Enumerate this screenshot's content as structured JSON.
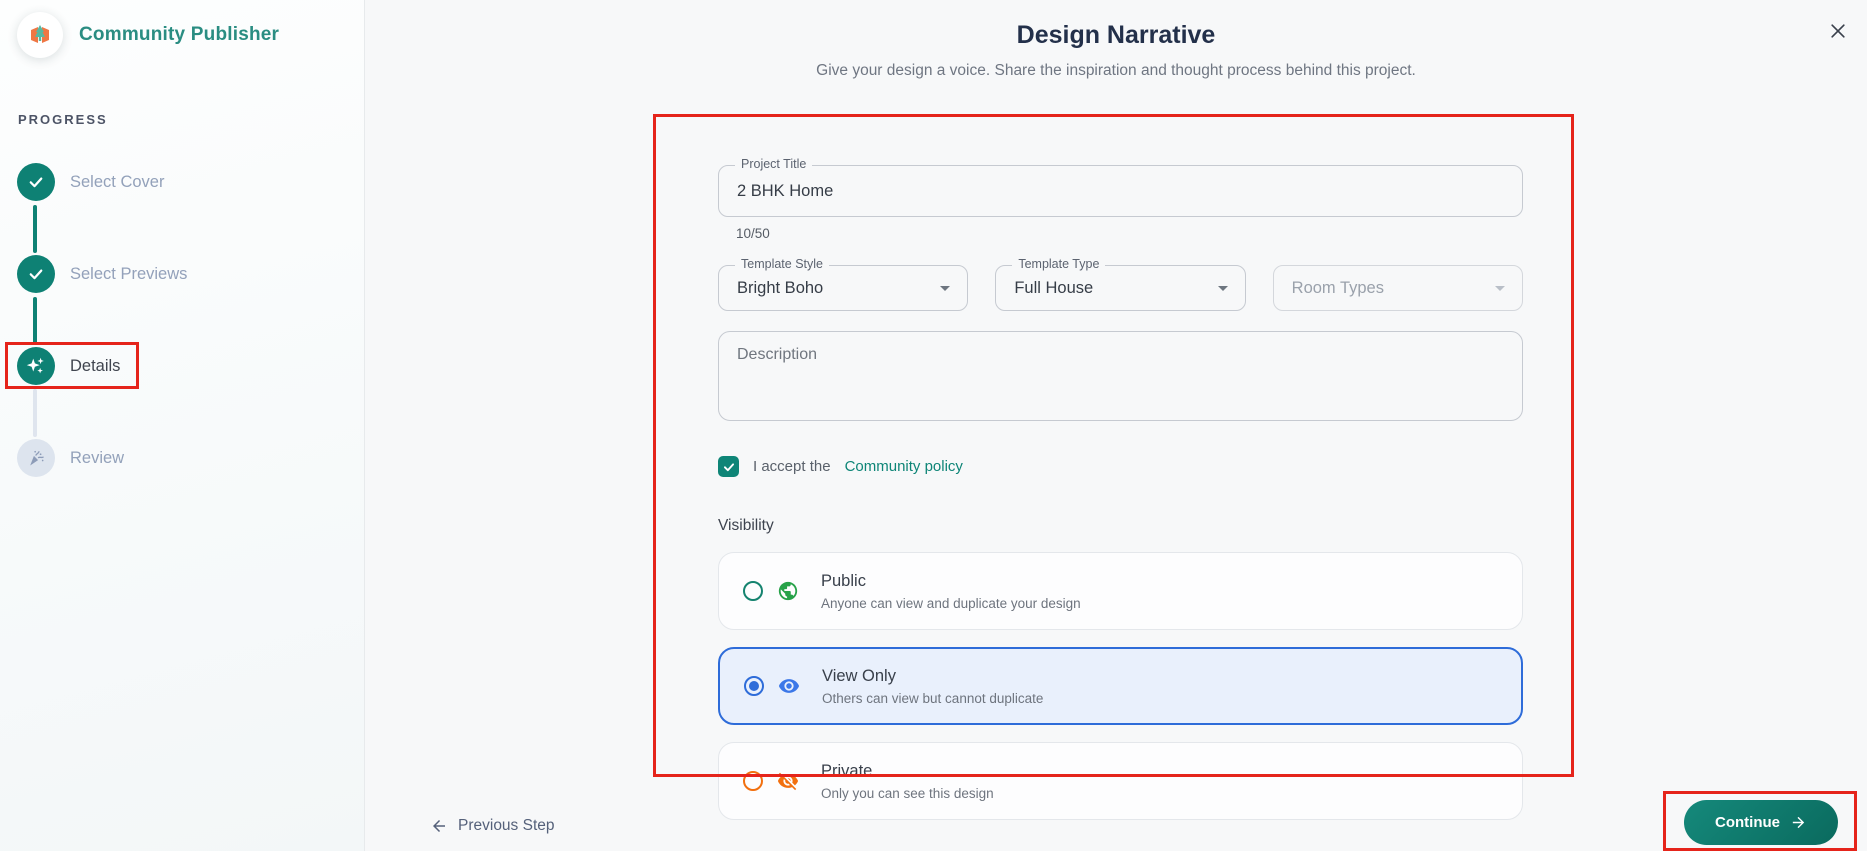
{
  "sidebar": {
    "app_title": "Community Publisher",
    "progress_label": "PROGRESS",
    "steps": [
      {
        "label": "Select Cover",
        "state": "completed",
        "icon": "check-icon"
      },
      {
        "label": "Select Previews",
        "state": "completed",
        "icon": "check-icon"
      },
      {
        "label": "Details",
        "state": "current",
        "icon": "sparkles-icon",
        "annotated": true
      },
      {
        "label": "Review",
        "state": "upcoming",
        "icon": "party-popper-icon"
      }
    ]
  },
  "header": {
    "title": "Design Narrative",
    "subtitle": "Give your design a voice. Share the inspiration and thought process behind this project."
  },
  "form": {
    "project_title": {
      "label": "Project Title",
      "value": "2 BHK Home",
      "counter": "10/50"
    },
    "template_style": {
      "label": "Template Style",
      "value": "Bright Boho"
    },
    "template_type": {
      "label": "Template Type",
      "value": "Full House"
    },
    "room_types": {
      "placeholder": "Room Types",
      "disabled": true
    },
    "description": {
      "placeholder": "Description",
      "value": ""
    },
    "policy": {
      "prefix": "I accept the",
      "link_label": "Community policy",
      "checked": true
    },
    "visibility": {
      "label": "Visibility",
      "options": [
        {
          "title": "Public",
          "description": "Anyone can view and duplicate your design",
          "selected": false,
          "icon": "globe-icon",
          "accent": "#27A249"
        },
        {
          "title": "View Only",
          "description": "Others can view but cannot duplicate",
          "selected": true,
          "icon": "eye-icon",
          "accent": "#2E6CD9"
        },
        {
          "title": "Private",
          "description": "Only you can see this design",
          "selected": false,
          "icon": "eye-off-icon",
          "accent": "#F2700F"
        }
      ]
    }
  },
  "footer": {
    "previous_label": "Previous Step",
    "continue_label": "Continue"
  },
  "colors": {
    "brand_teal": "#0E8174",
    "annotation_red": "#E5241B",
    "selected_blue": "#2E6CD9",
    "page_background": "#F7F8F9"
  }
}
